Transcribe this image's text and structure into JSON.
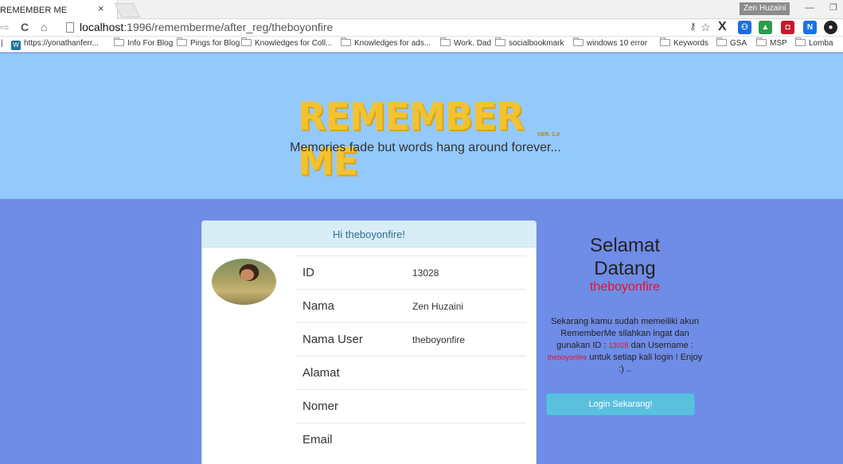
{
  "browser": {
    "tab_title": "REMEMBER ME",
    "tab_close": "×",
    "user_name": "Zen Huzaini",
    "url_host": "localhost",
    "url_path": ":1996/rememberme/after_reg/theboyonfire",
    "bookmarks": [
      "https://yonathanferr...",
      "Info For Blog",
      "Pings for Blog",
      "Knowledges for Coll...",
      "Knowledges for ads...",
      "Work. Dad",
      "socialbookmark",
      "windows 10 error",
      "Keywords",
      "GSA",
      "MSP",
      "Lomba"
    ]
  },
  "hero": {
    "logo_text": "REMEMBER ME",
    "version": "VER. 1.0",
    "tagline": "Memories fade but words hang around forever..."
  },
  "card": {
    "greeting": "Hi theboyonfire!",
    "rows": [
      {
        "label": "ID",
        "value": "13028"
      },
      {
        "label": "Nama",
        "value": "Zen Huzaini"
      },
      {
        "label": "Nama User",
        "value": "theboyonfire"
      },
      {
        "label": "Alamat",
        "value": ""
      },
      {
        "label": "Nomer",
        "value": ""
      },
      {
        "label": "Email",
        "value": ""
      }
    ]
  },
  "welcome": {
    "line1": "Selamat",
    "line2": "Datang",
    "username": "theboyonfire",
    "text_part1": "Sekarang kamu sudah memeiliki akun RememberMe silahkan ingat dan gunakan ID : ",
    "id_value": "13028",
    "text_part2": " dan Username : ",
    "username_value": "theboyonfire",
    "text_part3": " untuk setiap kali login ! Enjoy :) ..",
    "login_button": "Login Sekarang!"
  }
}
